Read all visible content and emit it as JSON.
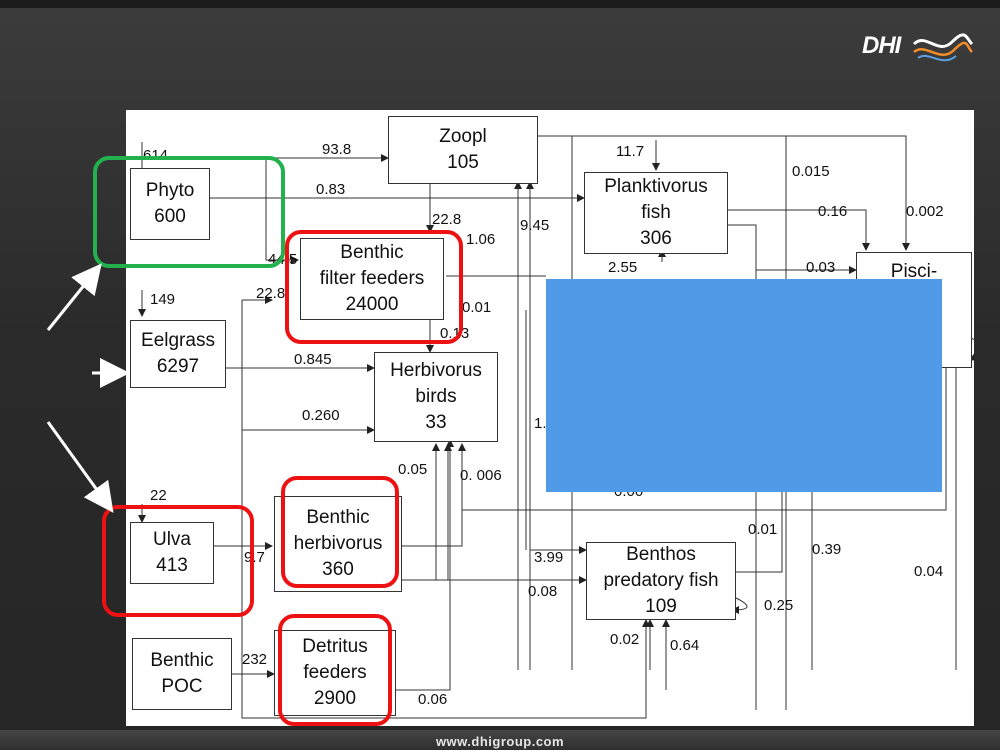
{
  "logo": {
    "text": "DHI"
  },
  "footer": {
    "url": "www.dhigroup.com"
  },
  "nodes": {
    "zoopl": {
      "label": "Zoopl\n105"
    },
    "phyto": {
      "label": "Phyto\n600"
    },
    "planktivorus": {
      "label": "Planktivorus\nfish\n306"
    },
    "benthic_filter": {
      "label": "Benthic\nfilter feeders\n24000"
    },
    "eelgrass": {
      "label": "Eelgrass\n6297"
    },
    "herbivorus_birds": {
      "label": "Herbivorus\nbirds\n33"
    },
    "pisci": {
      "label": "Pisci-\nvorus"
    },
    "ulva": {
      "label": "Ulva\n413"
    },
    "benthic_herbivorus": {
      "label": "Benthic\nherbivorus\n360"
    },
    "benthos_predatory": {
      "label": "Benthos\npredatory fish\n109"
    },
    "benthic_poc": {
      "label": "Benthic\nPOC"
    },
    "detritus_feeders": {
      "label": "Detritus\nfeeders\n2900"
    }
  },
  "flows": {
    "f614": "614",
    "f93_8": "93.8",
    "f0_83": "0.83",
    "f11_7": "11.7",
    "f0_015": "0.015",
    "f0_16": "0.16",
    "f0_002": "0.002",
    "f22_8a": "22.8",
    "f1_06": "1.06",
    "f9_45": "9.45",
    "f44_5": "44.5",
    "f2_55": "2.55",
    "f0_03": "0.03",
    "f149": "149",
    "f22_8b": "22.8",
    "f0_01a": "0.01",
    "f0_13": "0.13",
    "f0_845": "0.845",
    "f0_260": "0.260",
    "f1_x": "1.",
    "f0_05": "0.05",
    "f0_006": "0. 006",
    "f0_xx": "0.00",
    "f22": "22",
    "f9_7": "9.7",
    "f0_01b": "0.01",
    "f3_99": "3.99",
    "f0_39": "0.39",
    "f0_04": "0.04",
    "f0_08": "0.08",
    "f0_25": "0.25",
    "f0_02": "0.02",
    "f0_64": "0.64",
    "f232": "232",
    "f0_06": "0.06"
  },
  "colors": {
    "highlight_green": "#22b14c",
    "highlight_red": "#ee1111",
    "overlay_blue": "#4f9be8"
  }
}
